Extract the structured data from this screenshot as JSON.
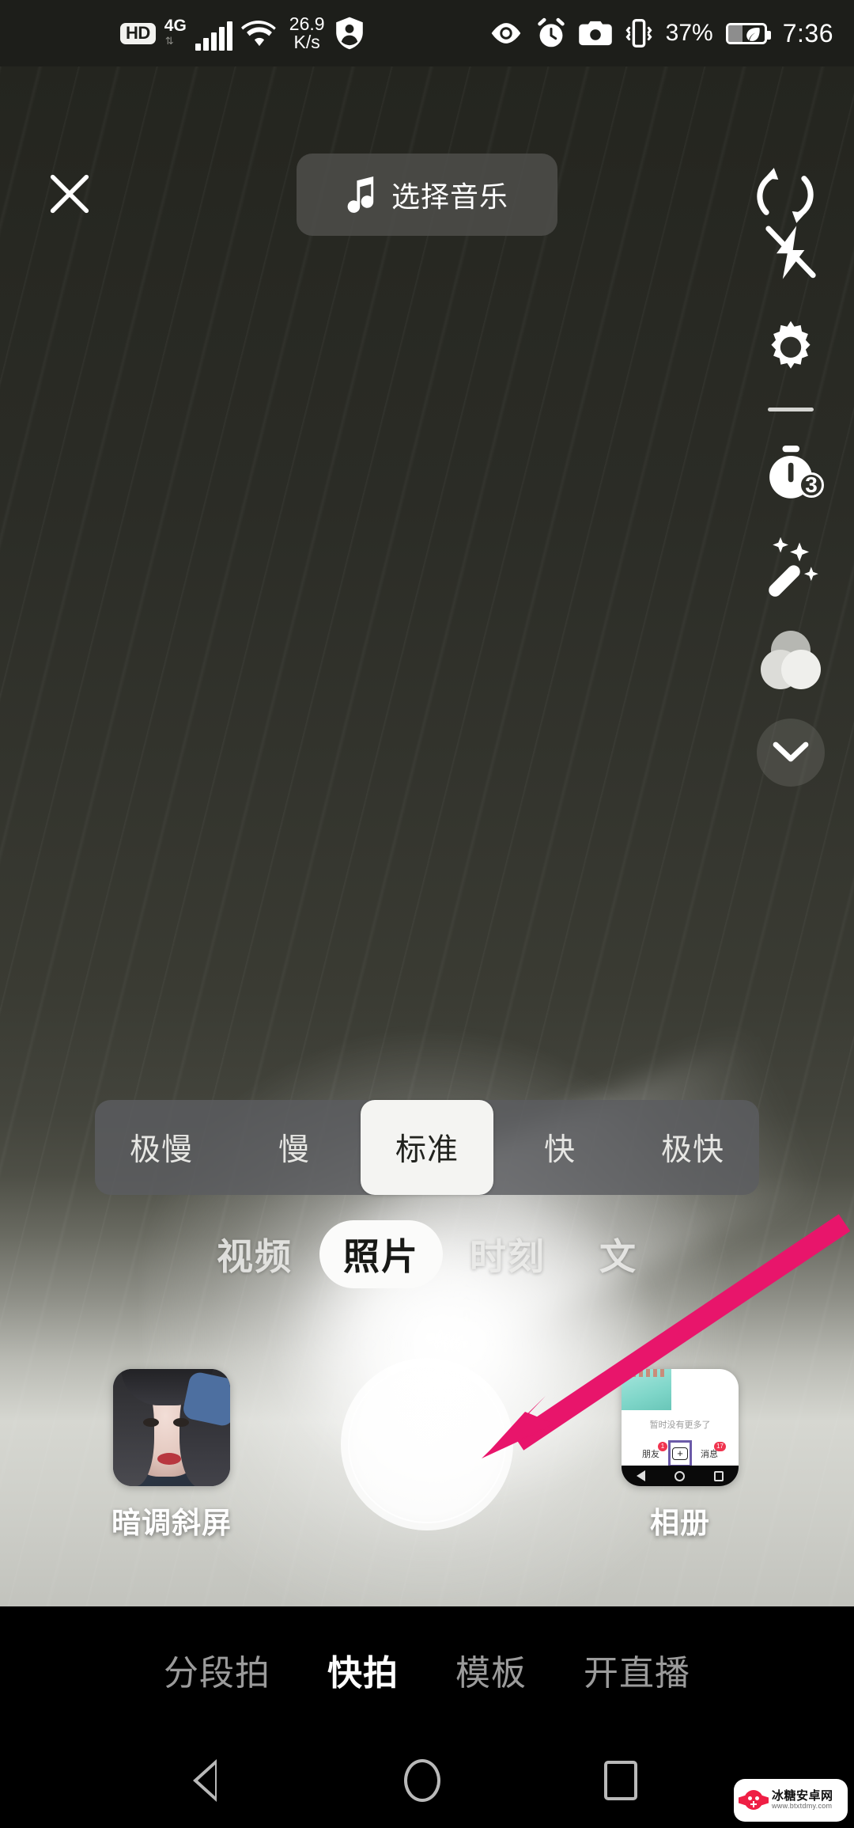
{
  "status_bar": {
    "hd_label": "HD",
    "network_type": "4G",
    "data_speed_value": "26.9",
    "data_speed_unit": "K/s",
    "battery_percent": "37%",
    "time": "7:36",
    "icons": [
      "hd-badge",
      "signal-bars-icon",
      "wifi-icon",
      "shield-person-icon",
      "eye-icon",
      "alarm-clock-icon",
      "camera-icon",
      "vibrate-icon",
      "battery-eco-icon"
    ]
  },
  "top_bar": {
    "close_icon": "close-icon",
    "music_button_label": "选择音乐",
    "music_note_icon": "music-note-icon",
    "flip_camera_icon": "flip-camera-icon"
  },
  "right_rail": {
    "items": [
      {
        "name": "flash-off-icon",
        "label": ""
      },
      {
        "name": "settings-gear-icon",
        "label": ""
      },
      {
        "name": "divider",
        "label": ""
      },
      {
        "name": "timer-icon",
        "label": "3"
      },
      {
        "name": "beauty-wand-icon",
        "label": ""
      },
      {
        "name": "filter-icon",
        "label": ""
      },
      {
        "name": "chevron-down-icon",
        "label": ""
      }
    ],
    "timer_value": "3"
  },
  "speed_selector": {
    "options": [
      "极慢",
      "慢",
      "标准",
      "快",
      "极快"
    ],
    "selected_index": 2
  },
  "mode_tabs": {
    "items": [
      "视频",
      "照片",
      "时刻",
      "文"
    ],
    "selected_index": 1
  },
  "controls": {
    "effect_label": "暗调斜屏",
    "shutter_name": "shutter-button",
    "album_label": "相册",
    "album_preview": {
      "empty_text": "暂时没有更多了",
      "nav_friends": "朋友",
      "nav_friends_badge": "1",
      "nav_messages": "消息",
      "nav_messages_badge": "17",
      "plus_icon": "+"
    }
  },
  "bottom_nav": {
    "items": [
      "分段拍",
      "快拍",
      "模板",
      "开直播"
    ],
    "selected_index": 1
  },
  "system_nav": {
    "back_icon": "back-triangle-icon",
    "home_icon": "home-circle-icon",
    "recents_icon": "recents-square-icon"
  },
  "annotation": {
    "arrow_color": "#e91e63",
    "arrow_name": "pointer-arrow"
  },
  "watermark": {
    "site_name": "冰糖安卓网",
    "url": "www.btxtdmy.com"
  },
  "colors": {
    "accent_pink": "#e91e63",
    "status_bg": "#1d1e1a",
    "selected_white": "#f4f4f2"
  }
}
